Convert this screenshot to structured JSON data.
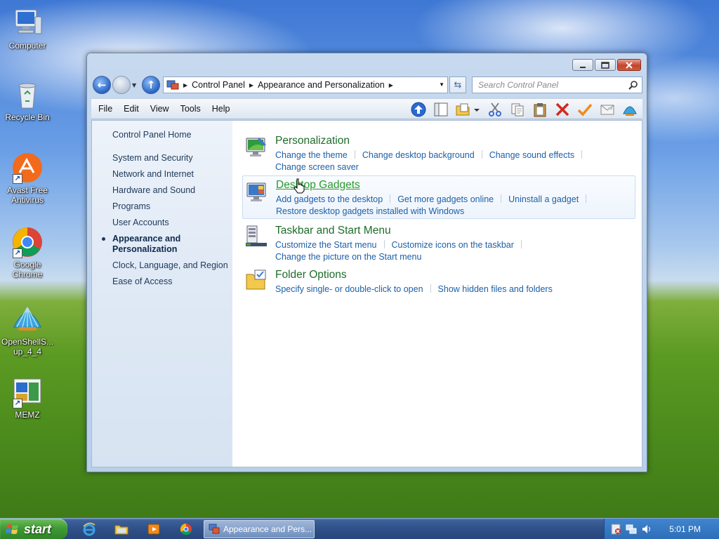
{
  "desktop": {
    "icons": [
      {
        "label": "Computer",
        "icon": "computer-icon"
      },
      {
        "label": "Recycle Bin",
        "icon": "recycle-bin-icon"
      },
      {
        "label": "Avast Free Antivirus",
        "icon": "avast-icon"
      },
      {
        "label": "Google Chrome",
        "icon": "chrome-icon"
      },
      {
        "label": "OpenShellS... up_4_4",
        "icon": "openshell-icon"
      },
      {
        "label": "MEMZ",
        "icon": "memz-icon"
      }
    ]
  },
  "window": {
    "title": "Appearance and Personalization",
    "address": {
      "crumbs": [
        "Control Panel",
        "Appearance and Personalization"
      ]
    },
    "search": {
      "placeholder": "Search Control Panel"
    },
    "menu": [
      "File",
      "Edit",
      "View",
      "Tools",
      "Help"
    ],
    "toolbar_icons": [
      "up-icon",
      "folders-pane-icon",
      "views-icon",
      "cut-icon",
      "copy-icon",
      "paste-icon",
      "delete-icon",
      "properties-icon",
      "undo-icon",
      "openshell-icon"
    ],
    "sidebar": {
      "home": "Control Panel Home",
      "items": [
        {
          "label": "System and Security"
        },
        {
          "label": "Network and Internet"
        },
        {
          "label": "Hardware and Sound"
        },
        {
          "label": "Programs"
        },
        {
          "label": "User Accounts"
        },
        {
          "label": "Appearance and Personalization",
          "active": true
        },
        {
          "label": "Clock, Language, and Region"
        },
        {
          "label": "Ease of Access"
        }
      ]
    },
    "categories": [
      {
        "title": "Personalization",
        "icon": "personalization-icon",
        "links": [
          "Change the theme",
          "Change desktop background",
          "Change sound effects",
          "Change screen saver"
        ]
      },
      {
        "title": "Desktop Gadgets",
        "icon": "gadgets-icon",
        "links": [
          "Add gadgets to the desktop",
          "Get more gadgets online",
          "Uninstall a gadget",
          "Restore desktop gadgets installed with Windows"
        ]
      },
      {
        "title": "Taskbar and Start Menu",
        "icon": "taskbar-icon",
        "links": [
          "Customize the Start menu",
          "Customize icons on the taskbar",
          "Change the picture on the Start menu"
        ]
      },
      {
        "title": "Folder Options",
        "icon": "folder-options-icon",
        "links": [
          "Specify single- or double-click to open",
          "Show hidden files and folders"
        ]
      }
    ]
  },
  "taskbar": {
    "start_label": "start",
    "task_label": "Appearance and Pers...",
    "clock": "5:01 PM"
  }
}
